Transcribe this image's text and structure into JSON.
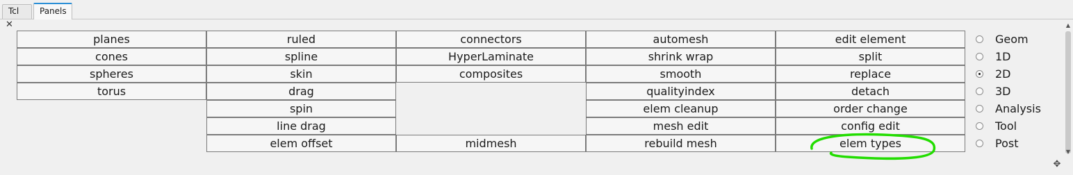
{
  "tabs": [
    {
      "label": "Tcl",
      "active": false
    },
    {
      "label": "Panels",
      "active": true
    }
  ],
  "close_icon": "close-icon",
  "panel_columns": [
    {
      "items": [
        "planes",
        "cones",
        "spheres",
        "torus"
      ]
    },
    {
      "items": [
        "ruled",
        "spline",
        "skin",
        "drag",
        "spin",
        "line drag",
        "elem offset"
      ]
    },
    {
      "items": [
        "connectors",
        "HyperLaminate",
        "composites",
        "midmesh"
      ]
    },
    {
      "items": [
        "automesh",
        "shrink wrap",
        "smooth",
        "qualityindex",
        "elem cleanup",
        "mesh edit",
        "rebuild mesh"
      ]
    },
    {
      "items": [
        "edit element",
        "split",
        "replace",
        "detach",
        "order change",
        "config edit",
        "elem types"
      ]
    }
  ],
  "page_selector": {
    "options": [
      "Geom",
      "1D",
      "2D",
      "3D",
      "Analysis",
      "Tool",
      "Post"
    ],
    "selected": "2D"
  },
  "scrollbar": {
    "up_icon": "arrow-up-icon",
    "down_icon": "arrow-down-icon"
  },
  "corner_icon": "move-icon",
  "annotation": {
    "color": "#22dd00"
  }
}
